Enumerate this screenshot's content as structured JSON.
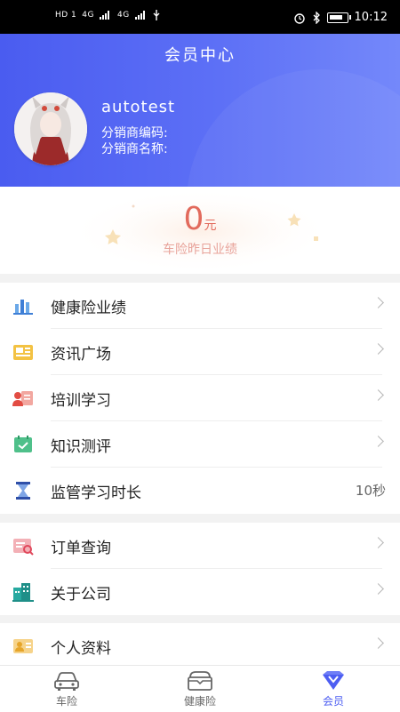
{
  "status_bar": {
    "left_text": [
      "HD 1",
      "4G",
      "4G"
    ],
    "time": "10:12"
  },
  "header": {
    "title": "会员中心",
    "username": "autotest",
    "distributor_code_label": "分销商编码:",
    "distributor_name_label": "分销商名称:"
  },
  "performance": {
    "value": "0",
    "unit": "元",
    "label": "车险昨日业绩"
  },
  "menu_groups": [
    [
      {
        "label": "健康险业绩",
        "icon": "bar-chart-icon"
      },
      {
        "label": "资讯广场",
        "icon": "news-icon"
      },
      {
        "label": "培训学习",
        "icon": "training-icon"
      },
      {
        "label": "知识测评",
        "icon": "quiz-icon"
      },
      {
        "label": "监管学习时长",
        "icon": "hourglass-icon",
        "value": "10秒"
      }
    ],
    [
      {
        "label": "订单查询",
        "icon": "order-icon"
      },
      {
        "label": "关于公司",
        "icon": "building-icon"
      }
    ],
    [
      {
        "label": "个人资料",
        "icon": "profile-card-icon"
      }
    ]
  ],
  "tabs": [
    {
      "label": "车险",
      "icon": "car-icon"
    },
    {
      "label": "健康险",
      "icon": "health-box-icon"
    },
    {
      "label": "会员",
      "icon": "member-diamond-icon",
      "active": true
    }
  ],
  "colors": {
    "header_start": "#4a5cf0",
    "header_end": "#7488fa",
    "accent": "#4d5ef2",
    "performance_value": "#e26a5c"
  }
}
